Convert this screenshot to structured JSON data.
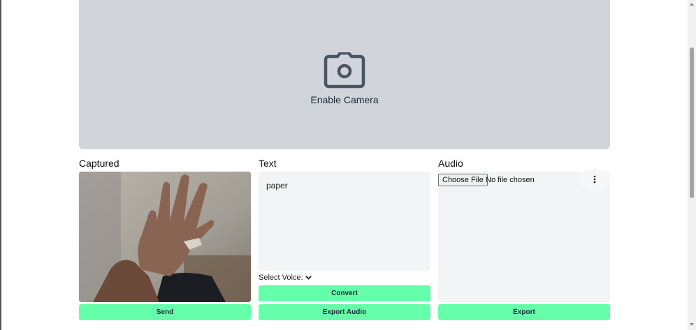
{
  "camera": {
    "label": "Enable Camera",
    "icon": "camera-icon"
  },
  "captured": {
    "title": "Captured",
    "send_label": "Send"
  },
  "text": {
    "title": "Text",
    "value": "paper",
    "voice_label": "Select Voice:",
    "convert_label": "Convert",
    "export_audio_label": "Export Audio"
  },
  "audio": {
    "title": "Audio",
    "choose_file_label": "Choose File",
    "file_status": "No file chosen",
    "export_label": "Export"
  },
  "colors": {
    "accent_button": "#66ffaa",
    "camera_bg": "#d1d5db",
    "panel_bg": "#f3f4f6"
  }
}
